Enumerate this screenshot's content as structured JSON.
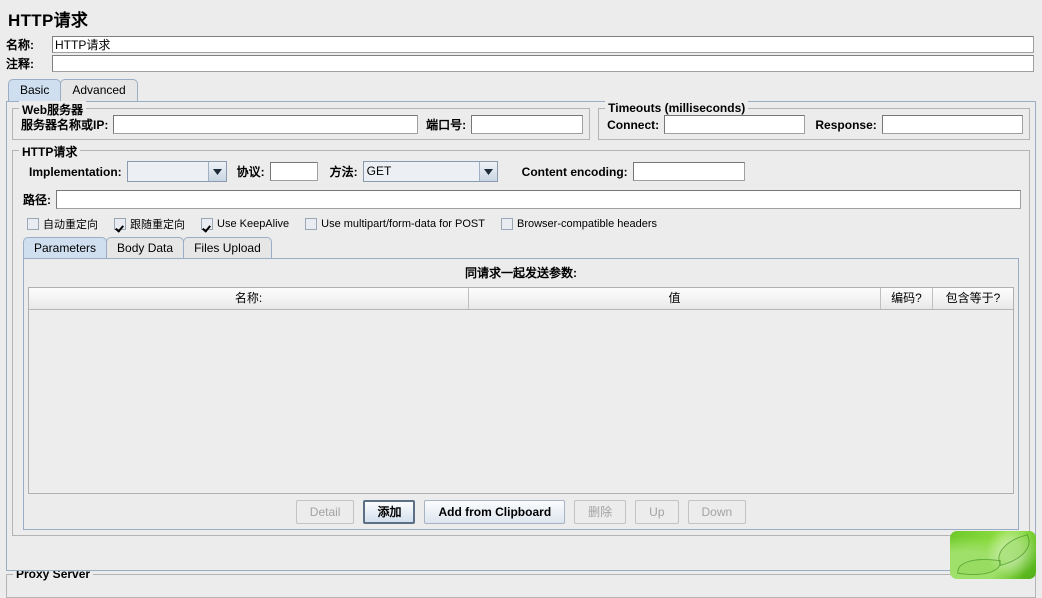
{
  "page": {
    "title": "HTTP请求"
  },
  "name_field": {
    "label": "名称:",
    "value": "HTTP请求"
  },
  "comment_field": {
    "label": "注释:",
    "value": ""
  },
  "tabs": [
    {
      "label": "Basic",
      "selected": true
    },
    {
      "label": "Advanced",
      "selected": false
    }
  ],
  "web_server": {
    "title": "Web服务器",
    "server_label": "服务器名称或IP:",
    "server_value": "",
    "port_label": "端口号:",
    "port_value": ""
  },
  "timeouts": {
    "title": "Timeouts (milliseconds)",
    "connect_label": "Connect:",
    "connect_value": "",
    "response_label": "Response:",
    "response_value": ""
  },
  "http_request": {
    "title": "HTTP请求",
    "implementation_label": "Implementation:",
    "implementation_value": "",
    "protocol_label": "协议:",
    "protocol_value": "",
    "method_label": "方法:",
    "method_value": "GET",
    "content_encoding_label": "Content encoding:",
    "content_encoding_value": "",
    "path_label": "路径:",
    "path_value": ""
  },
  "checkboxes": [
    {
      "label": "自动重定向",
      "checked": false
    },
    {
      "label": "跟随重定向",
      "checked": true
    },
    {
      "label": "Use KeepAlive",
      "checked": true
    },
    {
      "label": "Use multipart/form-data for POST",
      "checked": false
    },
    {
      "label": "Browser-compatible headers",
      "checked": false
    }
  ],
  "inner_tabs": [
    {
      "label": "Parameters",
      "selected": true
    },
    {
      "label": "Body Data",
      "selected": false
    },
    {
      "label": "Files Upload",
      "selected": false
    }
  ],
  "params": {
    "title": "同请求一起发送参数:",
    "columns": [
      "名称:",
      "值",
      "编码?",
      "包含等于?"
    ],
    "rows": []
  },
  "buttons": [
    {
      "label": "Detail",
      "enabled": false,
      "focused": false
    },
    {
      "label": "添加",
      "enabled": true,
      "focused": true
    },
    {
      "label": "Add from Clipboard",
      "enabled": true,
      "focused": false
    },
    {
      "label": "删除",
      "enabled": false,
      "focused": false
    },
    {
      "label": "Up",
      "enabled": false,
      "focused": false
    },
    {
      "label": "Down",
      "enabled": false,
      "focused": false
    }
  ],
  "proxy_server": {
    "title": "Proxy Server"
  },
  "overlay": {
    "name": "green-leaf-image"
  },
  "colors": {
    "background": "#ececec",
    "panel_border": "#9badc4",
    "selected_tab": "#cfdff0",
    "field_background": "#ffffff",
    "table_body": "#ededed",
    "leaf_green": "#6ec82a"
  }
}
